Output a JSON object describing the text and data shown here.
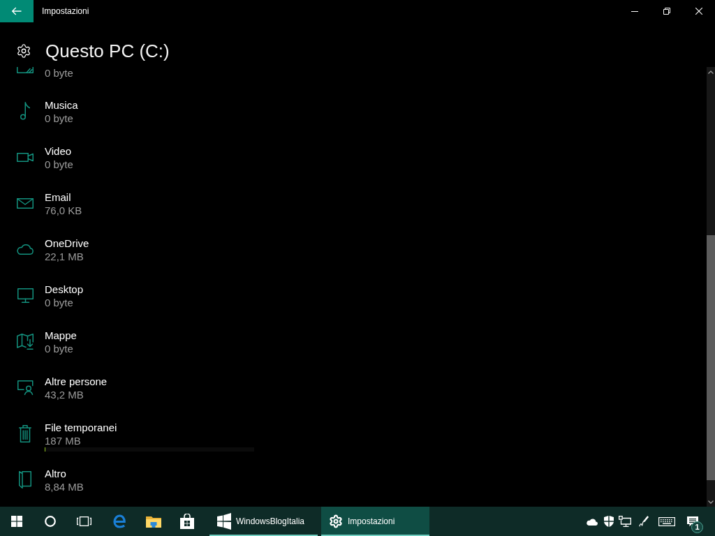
{
  "window": {
    "title": "Impostazioni"
  },
  "page": {
    "title": "Questo PC (C:)"
  },
  "categories": [
    {
      "kind": "pictures",
      "size": "0 byte"
    },
    {
      "kind": "music",
      "name": "Musica",
      "size": "0 byte"
    },
    {
      "kind": "video",
      "name": "Video",
      "size": "0 byte"
    },
    {
      "kind": "mail",
      "name": "Email",
      "size": "76,0 KB"
    },
    {
      "kind": "cloud",
      "name": "OneDrive",
      "size": "22,1 MB"
    },
    {
      "kind": "desktop",
      "name": "Desktop",
      "size": "0 byte"
    },
    {
      "kind": "maps",
      "name": "Mappe",
      "size": "0 byte"
    },
    {
      "kind": "users",
      "name": "Altre persone",
      "size": "43,2 MB"
    },
    {
      "kind": "temp",
      "name": "File temporanei",
      "size": "187 MB",
      "level": 0.004
    },
    {
      "kind": "other",
      "name": "Altro",
      "size": "8,84 MB"
    }
  ],
  "taskbar": {
    "apps": [
      {
        "kind": "website",
        "label": "WindowsBlogItalia",
        "selected": false
      },
      {
        "kind": "settings",
        "label": "Impostazioni",
        "selected": true
      }
    ],
    "notification_count": "1"
  }
}
